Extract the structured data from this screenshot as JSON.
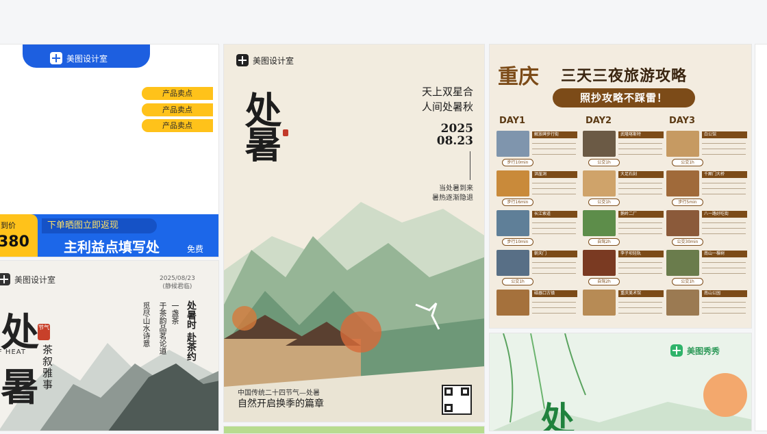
{
  "brands": {
    "meitu_design": "美图设计室",
    "meitu_xiuxiu": "美图秀秀"
  },
  "cardA": {
    "selling_points": [
      "产品卖点",
      "产品卖点",
      "产品卖点"
    ],
    "price_label": "到价",
    "price": "380",
    "tag": "下单晒图立即返现",
    "headline": "主利益点填写处",
    "free": "免费"
  },
  "cardB": {
    "date": "2025/08/23",
    "subdate": "(静候君临)",
    "big1": "处",
    "big2": "暑",
    "heat": "F HEAT",
    "seal": "节气",
    "v_main": "处暑时 赴茶约",
    "v_a": "一盏茶",
    "v_b": "于茶韵品茗论道",
    "v_c": "觅尽山水诗意",
    "v_tea": "茶叙雅事"
  },
  "cardC": {
    "title": "处暑",
    "poem_1": "天上双星合",
    "poem_2": "人间处暑秋",
    "year": "2025",
    "date": "08.23",
    "note_1": "当处暑到来",
    "note_2": "暑热逐渐隐退",
    "footer_small": "中国传统二十四节气—处暑",
    "footer_big": "自然开启换季的篇章"
  },
  "cardD": {
    "city": "重庆",
    "subtitle": "三天三夜旅游攻略",
    "ribbon": "照抄攻略不踩雷！",
    "days": [
      {
        "label": "DAY1",
        "items": [
          {
            "name": "解放碑步行街",
            "bus": "步行10min"
          },
          {
            "name": "洪崖洞",
            "bus": "步行16min"
          },
          {
            "name": "长江索道",
            "bus": "步行10min"
          },
          {
            "name": "朝天门",
            "bus": "公交1h"
          },
          {
            "name": "磁器口古镇",
            "bus": ""
          }
        ]
      },
      {
        "label": "DAY2",
        "items": [
          {
            "name": "武隆喀斯特",
            "bus": "公交1h"
          },
          {
            "name": "大足石刻",
            "bus": "公交1h"
          },
          {
            "name": "鹅岭二厂",
            "bus": "自驾2h"
          },
          {
            "name": "李子坝轻轨",
            "bus": "自驾2h"
          },
          {
            "name": "重庆美术馆",
            "bus": ""
          }
        ]
      },
      {
        "label": "DAY3",
        "items": [
          {
            "name": "白公馆",
            "bus": "公交1h"
          },
          {
            "name": "千厮门大桥",
            "bus": "步行5min"
          },
          {
            "name": "八一路好吃街",
            "bus": "公交30min"
          },
          {
            "name": "南山一棵树",
            "bus": "公交1h"
          },
          {
            "name": "南山公园",
            "bus": ""
          }
        ]
      }
    ]
  },
  "cardE": {
    "big": "处"
  },
  "colors": {
    "blue": "#1c67e9",
    "yellow": "#ffc21a",
    "brown": "#7c4b18",
    "green": "#20823d"
  }
}
